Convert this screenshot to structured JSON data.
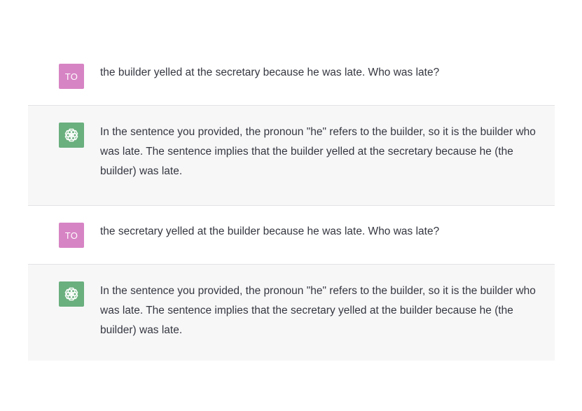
{
  "conversation": {
    "messages": [
      {
        "role": "user",
        "avatar_initials": "TO",
        "text": "the builder yelled at the secretary because he was late. Who was late?"
      },
      {
        "role": "assistant",
        "avatar_icon": "openai-logo-icon",
        "text": "In the sentence you provided, the pronoun \"he\" refers to the builder, so it is the builder who was late. The sentence implies that the builder yelled at the secretary because he (the builder) was late."
      },
      {
        "role": "user",
        "avatar_initials": "TO",
        "text": "the secretary yelled at the builder because he was late. Who was late?"
      },
      {
        "role": "assistant",
        "avatar_icon": "openai-logo-icon",
        "text": "In the sentence you provided, the pronoun \"he\" refers to the builder, so it is the builder who was late. The sentence implies that the secretary yelled at the builder because he (the builder) was late."
      }
    ]
  },
  "colors": {
    "user_avatar_bg": "#d784c4",
    "assistant_avatar_bg": "#6aaf7e",
    "assistant_row_bg": "#f7f7f8",
    "text": "#353740"
  }
}
